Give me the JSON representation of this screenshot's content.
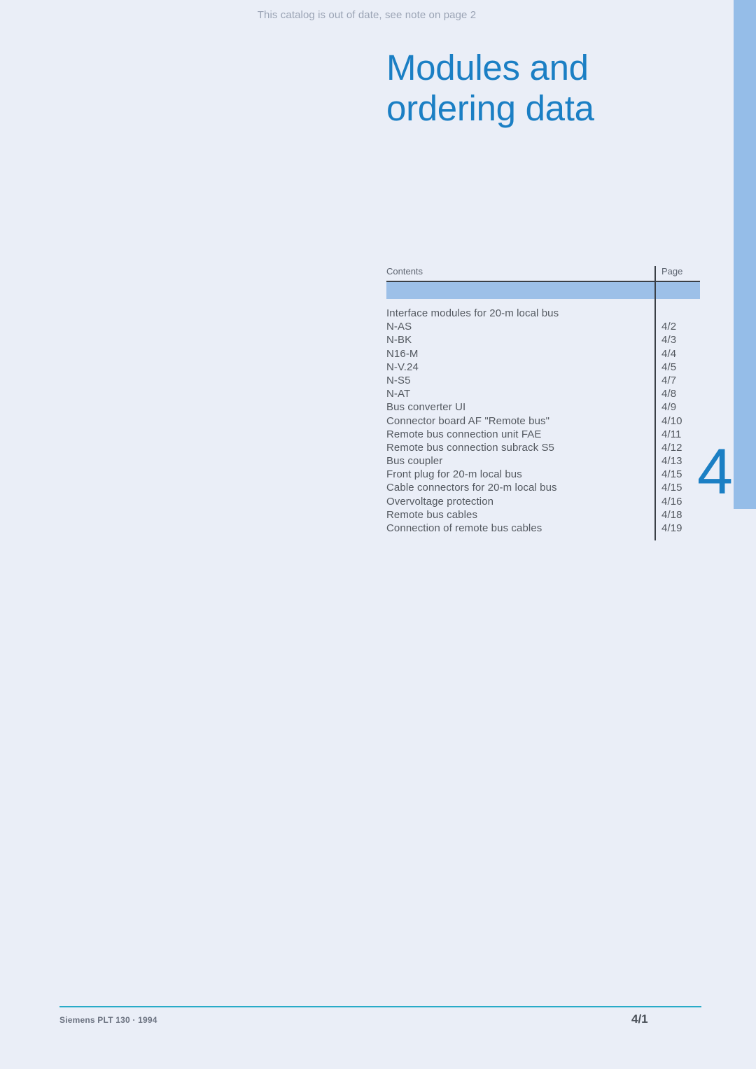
{
  "notice": "This catalog is out of date, see note on page 2",
  "title": {
    "line1": "Modules and",
    "line2": "ordering data"
  },
  "chapter": {
    "number": "4"
  },
  "toc": {
    "header_contents": "Contents",
    "header_page": "Page",
    "rows": [
      {
        "label": "Interface modules for 20-m local bus",
        "page": ""
      },
      {
        "label": "N-AS",
        "page": "4/2"
      },
      {
        "label": "N-BK",
        "page": "4/3"
      },
      {
        "label": "N16-M",
        "page": "4/4"
      },
      {
        "label": "N-V.24",
        "page": "4/5"
      },
      {
        "label": "N-S5",
        "page": "4/7"
      },
      {
        "label": "N-AT",
        "page": "4/8"
      },
      {
        "label": "Bus converter UI",
        "page": "4/9"
      },
      {
        "label": "Connector board AF \"Remote bus\"",
        "page": "4/10"
      },
      {
        "label": "Remote bus connection unit FAE",
        "page": "4/11"
      },
      {
        "label": "Remote bus connection subrack S5",
        "page": "4/12"
      },
      {
        "label": "Bus coupler",
        "page": "4/13"
      },
      {
        "label": "Front plug for 20-m local bus",
        "page": "4/15"
      },
      {
        "label": "Cable connectors for 20-m local bus",
        "page": "4/15"
      },
      {
        "label": "Overvoltage protection",
        "page": "4/16"
      },
      {
        "label": "Remote bus cables",
        "page": "4/18"
      },
      {
        "label": "Connection of remote bus cables",
        "page": "4/19"
      }
    ]
  },
  "footer": {
    "source": "Siemens PLT 130 · 1994",
    "page_number": "4/1"
  },
  "colors": {
    "background": "#eaeef7",
    "accent_blue": "#1b7fc4",
    "tab_blue": "#95bde8",
    "band_blue": "#9dc0e8",
    "rule_teal": "#29abc8",
    "rule_dark": "#3a3f46",
    "body_text": "#53585f",
    "notice_text": "#9aa3b4"
  }
}
